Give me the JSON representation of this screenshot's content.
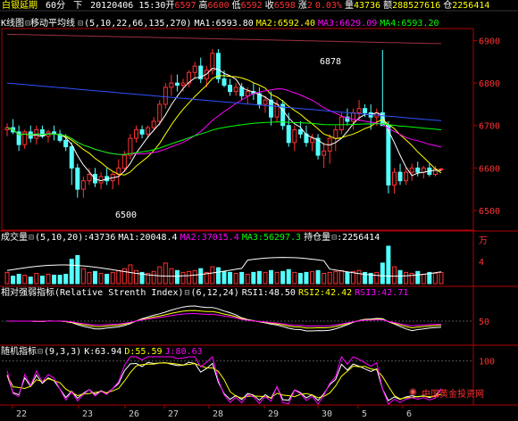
{
  "header": {
    "name": "白银延期",
    "period": "60分",
    "nav": "下",
    "datetime": "20120406 15:30",
    "open_label": "开",
    "open": "6597",
    "high_label": "高",
    "high": "6600",
    "low_label": "低",
    "low": "6592",
    "close_label": "收",
    "close": "6598",
    "change_label": "涨",
    "change": "2",
    "pct": "0.03%",
    "vol_label": "量",
    "vol": "43736",
    "amt_label": "额",
    "amt": "288527616",
    "oi_label": "仓",
    "oi": "2256414"
  },
  "main_panel": {
    "chart_label": "K线图",
    "indicator": "移动平均线",
    "params": "(5,10,22,66,135,270)",
    "ma1_label": "MA1:",
    "ma1": "6593.80",
    "ma2_label": "MA2:",
    "ma2": "6592.40",
    "ma3_label": "MA3:",
    "ma3": "6629.09",
    "ma4_label": "MA4:",
    "ma4": "6593.20",
    "peak_annotation": "6878",
    "trough_annotation": "6500"
  },
  "vol_panel": {
    "title": "成交量",
    "params": "(5,10,20)",
    "value": ":43736",
    "ma1_label": "MA1:",
    "ma1": "20048.4",
    "ma2_label": "MA2:",
    "ma2": "37015.4",
    "ma3_label": "MA3:",
    "ma3": "56297.3",
    "oi_label": "持仓量",
    "oi_value": ":2256414",
    "unit": "万"
  },
  "rsi_panel": {
    "title": "相对强弱指标(Relative Strenth Index)",
    "params": "(6,12,24)",
    "rsi1_label": "RSI1:",
    "rsi1": "48.50",
    "rsi2_label": "RSI2:",
    "rsi2": "42.42",
    "rsi3_label": "RSI3:",
    "rsi3": "42.71"
  },
  "kdj_panel": {
    "title": "随机指标",
    "params": "(9,3,3)",
    "k_label": "K:",
    "k": "63.94",
    "d_label": "D:",
    "d": "55.59",
    "j_label": "J:",
    "j": "80.63"
  },
  "x_axis": [
    {
      "label": "22"
    },
    {
      "label": "23"
    },
    {
      "label": "26"
    },
    {
      "label": "27"
    },
    {
      "label": "28"
    },
    {
      "label": "29"
    },
    {
      "label": "30"
    },
    {
      "label": "5"
    },
    {
      "label": "6"
    }
  ],
  "vol_axis": {
    "label_mid": "4"
  },
  "watermark": "中国黄金投资网",
  "colors": {
    "up": "#ff3232",
    "down": "#54ffff",
    "ma1": "#ffffff",
    "ma2": "#ffff00",
    "ma3": "#ff00ff",
    "ma4": "#00ff00",
    "ma5": "#3050ff",
    "ma6": "#9b3040",
    "axis": "#b00000",
    "label_red": "#ff3232"
  },
  "chart_data": [
    {
      "type": "candlestick",
      "title": "移动平均线",
      "ylim": [
        6460,
        6920
      ],
      "y_ticks": [
        6500,
        6600,
        6700,
        6800,
        6900
      ],
      "series": [
        {
          "name": "MA1",
          "value": 6593.8
        },
        {
          "name": "MA2",
          "value": 6592.4
        },
        {
          "name": "MA3",
          "value": 6629.09
        },
        {
          "name": "MA4",
          "value": 6593.2
        }
      ],
      "candles": [
        [
          6690,
          6705,
          6675,
          6695
        ],
        [
          6695,
          6715,
          6680,
          6685
        ],
        [
          6685,
          6700,
          6640,
          6655
        ],
        [
          6655,
          6690,
          6645,
          6685
        ],
        [
          6685,
          6700,
          6660,
          6670
        ],
        [
          6670,
          6700,
          6655,
          6690
        ],
        [
          6690,
          6700,
          6670,
          6675
        ],
        [
          6675,
          6690,
          6660,
          6685
        ],
        [
          6685,
          6700,
          6665,
          6680
        ],
        [
          6680,
          6690,
          6660,
          6665
        ],
        [
          6665,
          6680,
          6640,
          6650
        ],
        [
          6650,
          6660,
          6560,
          6600
        ],
        [
          6600,
          6610,
          6530,
          6550
        ],
        [
          6550,
          6580,
          6530,
          6570
        ],
        [
          6570,
          6600,
          6560,
          6585
        ],
        [
          6585,
          6600,
          6555,
          6565
        ],
        [
          6565,
          6590,
          6550,
          6580
        ],
        [
          6580,
          6600,
          6560,
          6570
        ],
        [
          6570,
          6590,
          6550,
          6585
        ],
        [
          6585,
          6620,
          6560,
          6600
        ],
        [
          6600,
          6640,
          6590,
          6630
        ],
        [
          6630,
          6680,
          6620,
          6670
        ],
        [
          6670,
          6700,
          6660,
          6690
        ],
        [
          6690,
          6700,
          6670,
          6680
        ],
        [
          6680,
          6700,
          6670,
          6695
        ],
        [
          6695,
          6720,
          6690,
          6710
        ],
        [
          6710,
          6760,
          6700,
          6750
        ],
        [
          6750,
          6800,
          6740,
          6790
        ],
        [
          6790,
          6820,
          6770,
          6800
        ],
        [
          6800,
          6820,
          6780,
          6795
        ],
        [
          6795,
          6810,
          6780,
          6800
        ],
        [
          6800,
          6830,
          6790,
          6825
        ],
        [
          6825,
          6850,
          6810,
          6840
        ],
        [
          6840,
          6860,
          6800,
          6810
        ],
        [
          6810,
          6840,
          6790,
          6830
        ],
        [
          6830,
          6880,
          6820,
          6870
        ],
        [
          6870,
          6880,
          6800,
          6810
        ],
        [
          6810,
          6830,
          6790,
          6795
        ],
        [
          6795,
          6810,
          6770,
          6780
        ],
        [
          6780,
          6800,
          6770,
          6790
        ],
        [
          6790,
          6800,
          6760,
          6770
        ],
        [
          6770,
          6790,
          6750,
          6780
        ],
        [
          6780,
          6800,
          6760,
          6775
        ],
        [
          6775,
          6790,
          6740,
          6750
        ],
        [
          6750,
          6770,
          6730,
          6760
        ],
        [
          6760,
          6780,
          6700,
          6720
        ],
        [
          6720,
          6760,
          6710,
          6750
        ],
        [
          6750,
          6760,
          6690,
          6700
        ],
        [
          6700,
          6730,
          6650,
          6660
        ],
        [
          6660,
          6700,
          6640,
          6690
        ],
        [
          6690,
          6710,
          6670,
          6680
        ],
        [
          6680,
          6700,
          6650,
          6660
        ],
        [
          6660,
          6680,
          6640,
          6670
        ],
        [
          6670,
          6680,
          6620,
          6630
        ],
        [
          6630,
          6660,
          6600,
          6640
        ],
        [
          6640,
          6680,
          6610,
          6670
        ],
        [
          6670,
          6700,
          6640,
          6690
        ],
        [
          6690,
          6730,
          6680,
          6720
        ],
        [
          6720,
          6740,
          6700,
          6710
        ],
        [
          6710,
          6740,
          6690,
          6730
        ],
        [
          6730,
          6760,
          6710,
          6740
        ],
        [
          6740,
          6750,
          6720,
          6730
        ],
        [
          6730,
          6750,
          6690,
          6720
        ],
        [
          6720,
          6740,
          6700,
          6730
        ],
        [
          6730,
          6878,
          6700,
          6700
        ],
        [
          6700,
          6710,
          6540,
          6560
        ],
        [
          6560,
          6600,
          6540,
          6590
        ],
        [
          6590,
          6610,
          6560,
          6570
        ],
        [
          6570,
          6600,
          6560,
          6590
        ],
        [
          6590,
          6610,
          6570,
          6600
        ],
        [
          6600,
          6615,
          6580,
          6590
        ],
        [
          6590,
          6605,
          6575,
          6600
        ],
        [
          6600,
          6610,
          6580,
          6585
        ],
        [
          6585,
          6605,
          6580,
          6598
        ],
        [
          6598,
          6600,
          6592,
          6598
        ]
      ]
    },
    {
      "type": "bar",
      "title": "成交量",
      "values": [
        12,
        8,
        10,
        9,
        7,
        11,
        8,
        10,
        9,
        9,
        10,
        26,
        30,
        16,
        12,
        13,
        11,
        10,
        12,
        14,
        16,
        20,
        14,
        12,
        11,
        13,
        18,
        22,
        16,
        14,
        12,
        13,
        14,
        16,
        12,
        18,
        17,
        13,
        12,
        11,
        12,
        10,
        12,
        13,
        12,
        14,
        12,
        13,
        15,
        12,
        11,
        12,
        13,
        14,
        11,
        12,
        13,
        14,
        12,
        13,
        14,
        12,
        11,
        12,
        22,
        40,
        18,
        14,
        12,
        11,
        13,
        10,
        12,
        11,
        12
      ]
    },
    {
      "type": "line",
      "title": "相对强弱指标(Relative Strenth Index)",
      "ylim": [
        0,
        100
      ],
      "series": [
        {
          "name": "RSI1",
          "value": 48.5
        },
        {
          "name": "RSI2",
          "value": 42.42
        },
        {
          "name": "RSI3",
          "value": 42.71
        }
      ]
    },
    {
      "type": "line",
      "title": "随机指标",
      "ylim": [
        0,
        100
      ],
      "series": [
        {
          "name": "K",
          "value": 63.94
        },
        {
          "name": "D",
          "value": 55.59
        },
        {
          "name": "J",
          "value": 80.63
        }
      ]
    }
  ]
}
